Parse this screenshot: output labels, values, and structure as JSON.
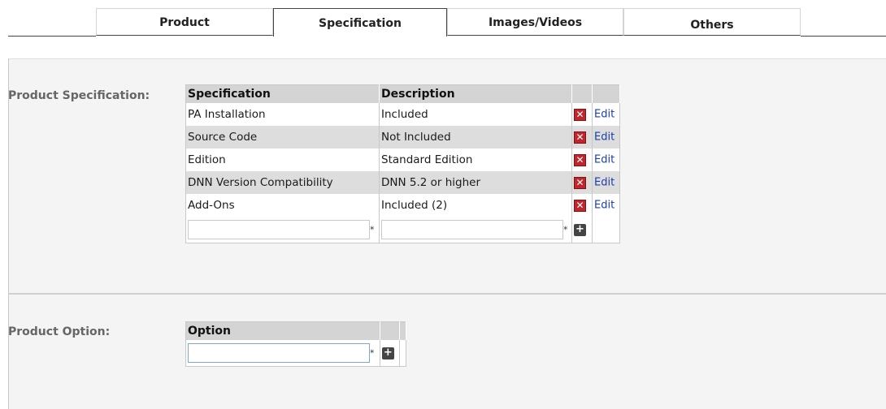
{
  "tabs": [
    {
      "label": "Product"
    },
    {
      "label": "Specification"
    },
    {
      "label": "Images/Videos"
    },
    {
      "label": "Others"
    }
  ],
  "spec_section": {
    "label": "Product Specification:",
    "headers": {
      "specification": "Specification",
      "description": "Description"
    },
    "rows": [
      {
        "specification": "PA Installation",
        "description": "Included",
        "edit": "Edit"
      },
      {
        "specification": "Source Code",
        "description": "Not Included",
        "edit": "Edit"
      },
      {
        "specification": "Edition",
        "description": "Standard Edition",
        "edit": "Edit"
      },
      {
        "specification": "DNN Version Compatibility",
        "description": "DNN 5.2 or higher",
        "edit": "Edit"
      },
      {
        "specification": "Add-Ons",
        "description": "Included (2)",
        "edit": "Edit"
      }
    ],
    "new_row": {
      "spec_value": "",
      "desc_value": "",
      "required_mark": "*"
    }
  },
  "option_section": {
    "label": "Product Option:",
    "header": "Option",
    "new_row": {
      "option_value": "",
      "required_mark": "*"
    }
  },
  "icons": {
    "delete": "delete-x-icon",
    "add": "plus-icon"
  },
  "colors": {
    "header_bg": "#d4d4d4",
    "delete_red": "#c0262c",
    "link_blue": "#1a3fa8",
    "panel_bg": "#f4f4f4"
  }
}
